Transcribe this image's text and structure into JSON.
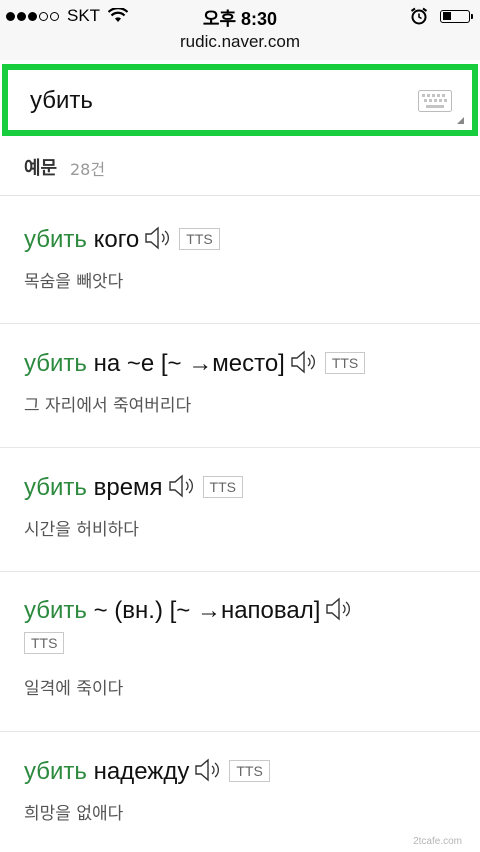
{
  "status_bar": {
    "carrier": "SKT",
    "time": "오후 8:30",
    "signal_bars": 3,
    "icons": [
      "signal-icon",
      "wifi-icon",
      "alarm-icon",
      "battery-icon"
    ]
  },
  "browser": {
    "url": "rudic.naver.com"
  },
  "search": {
    "value": "убить",
    "accent_color": "#19ce3e",
    "icons": [
      "keyboard-icon"
    ]
  },
  "section": {
    "title": "예문",
    "count": "28건"
  },
  "entries": [
    {
      "keyword": "убить",
      "rest": " кого",
      "tts": "TTS",
      "meaning": "목숨을 빼앗다"
    },
    {
      "keyword": "убить",
      "rest": " на ~е [~ →место]",
      "tts": "TTS",
      "meaning": "그 자리에서 죽여버리다"
    },
    {
      "keyword": "убить",
      "rest": " время",
      "tts": "TTS",
      "meaning": "시간을 허비하다"
    },
    {
      "keyword": "убить",
      "rest": " ~ (вн.) [~ →наповал]",
      "tts": "TTS",
      "meaning": "일격에 죽이다"
    },
    {
      "keyword": "убить",
      "rest": " надежду",
      "tts": "TTS",
      "meaning": "희망을 없애다"
    }
  ],
  "keyword_color": "#2c8a3e",
  "watermark": "2tcafe.com"
}
